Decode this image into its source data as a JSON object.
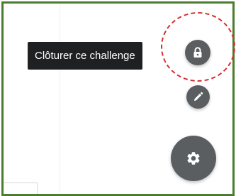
{
  "tooltip": {
    "text": "Clôturer ce challenge"
  },
  "actions": {
    "close_challenge_icon": "lock-icon",
    "edit_icon": "pencil-icon",
    "settings_icon": "gear-icon"
  },
  "colors": {
    "frame_border": "#4a7d2f",
    "tooltip_bg": "#1f2021",
    "fab_bg": "#5b5e61",
    "highlight": "#d32f2f"
  }
}
